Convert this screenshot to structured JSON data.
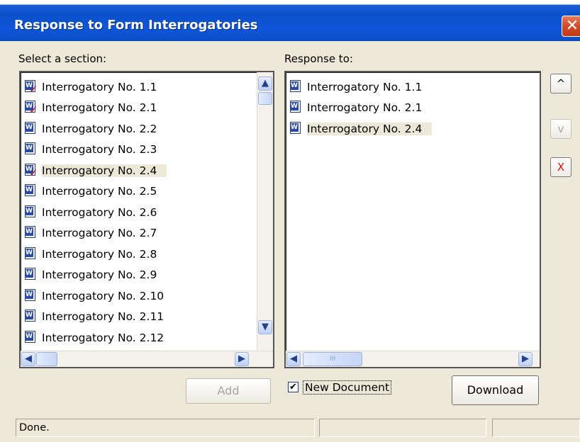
{
  "window": {
    "title": "Response to Form Interrogatories",
    "close_glyph": "✕"
  },
  "left_panel": {
    "label": "Select a section:",
    "items": [
      {
        "label": "Interrogatory No. 1.1",
        "checked": true,
        "selected": false
      },
      {
        "label": "Interrogatory No. 2.1",
        "checked": true,
        "selected": false
      },
      {
        "label": "Interrogatory No. 2.2",
        "checked": false,
        "selected": false
      },
      {
        "label": "Interrogatory No. 2.3",
        "checked": false,
        "selected": false
      },
      {
        "label": "Interrogatory No. 2.4",
        "checked": true,
        "selected": true
      },
      {
        "label": "Interrogatory No. 2.5",
        "checked": false,
        "selected": false
      },
      {
        "label": "Interrogatory No. 2.6",
        "checked": false,
        "selected": false
      },
      {
        "label": "Interrogatory No. 2.7",
        "checked": false,
        "selected": false
      },
      {
        "label": "Interrogatory No. 2.8",
        "checked": false,
        "selected": false
      },
      {
        "label": "Interrogatory No. 2.9",
        "checked": false,
        "selected": false
      },
      {
        "label": "Interrogatory No. 2.10",
        "checked": false,
        "selected": false
      },
      {
        "label": "Interrogatory No. 2.11",
        "checked": false,
        "selected": false
      },
      {
        "label": "Interrogatory No. 2.12",
        "checked": false,
        "selected": false
      }
    ]
  },
  "right_panel": {
    "label": "Response to:",
    "items": [
      {
        "label": "Interrogatory No. 1.1",
        "selected": false
      },
      {
        "label": "Interrogatory No. 2.1",
        "selected": false
      },
      {
        "label": "Interrogatory No. 2.4",
        "selected": true
      }
    ]
  },
  "side_buttons": {
    "up": "^",
    "down": "v",
    "remove": "X",
    "remove_color": "#d40f0f"
  },
  "buttons": {
    "add": "Add",
    "download": "Download"
  },
  "new_document": {
    "label": "New Document",
    "checked": true,
    "check_glyph": "✔"
  },
  "status": {
    "text": "Done."
  },
  "scroll_glyphs": {
    "up": "▲",
    "down": "▼",
    "left": "◀",
    "right": "▶",
    "grip": "III"
  }
}
